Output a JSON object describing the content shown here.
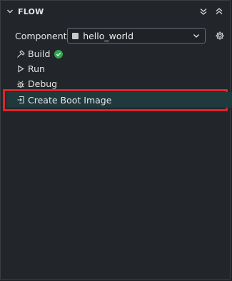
{
  "header": {
    "title": "FLOW"
  },
  "component": {
    "label": "Component",
    "selected": "hello_world"
  },
  "actions": [
    {
      "label": "Build",
      "status": "success"
    },
    {
      "label": "Run"
    },
    {
      "label": "Debug"
    },
    {
      "label": "Create Boot Image"
    }
  ],
  "colors": {
    "success": "#2fa84f",
    "highlight_border": "#e0242b",
    "selected_bg": "#20393d"
  }
}
